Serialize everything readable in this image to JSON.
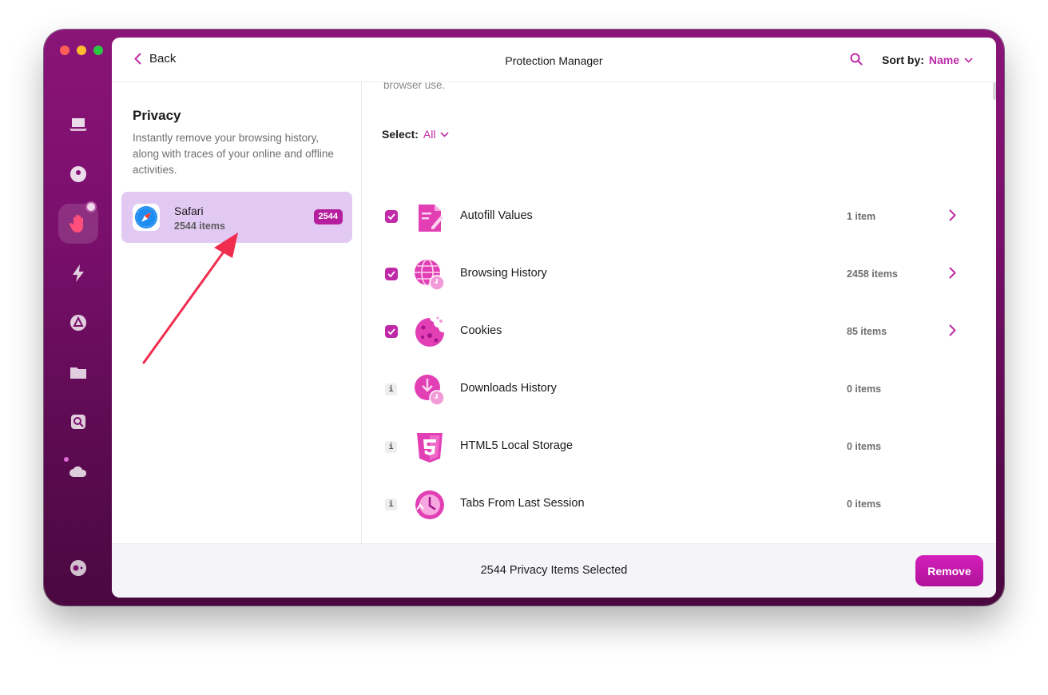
{
  "window": {
    "accent": "#c02aa8",
    "sidebar_color": "#7a0f6c"
  },
  "sidebar": {
    "items": [
      {
        "icon": "laptop-icon"
      },
      {
        "icon": "disc-icon"
      },
      {
        "icon": "hand-icon"
      },
      {
        "icon": "lightning-icon"
      },
      {
        "icon": "apps-icon"
      },
      {
        "icon": "folder-icon"
      },
      {
        "icon": "search-file-icon"
      },
      {
        "icon": "cloud-icon"
      },
      {
        "icon": "toggle-icon"
      }
    ]
  },
  "header": {
    "back_label": "Back",
    "title": "Protection Manager",
    "sort_label": "Sort by:",
    "sort_value": "Name"
  },
  "left": {
    "section_title": "Privacy",
    "section_description": "Instantly remove your browsing history, along with traces of your online and offline activities.",
    "app": {
      "name": "Safari",
      "count": "2544 items",
      "badge": "2544"
    }
  },
  "right": {
    "cut_text": "browser use.",
    "select_label": "Select:",
    "select_value": "All",
    "items": [
      {
        "label": "Autofill Values",
        "count": "1 item",
        "checked": true,
        "icon": "autofill-icon"
      },
      {
        "label": "Browsing History",
        "count": "2458 items",
        "checked": true,
        "icon": "globe-clock-icon"
      },
      {
        "label": "Cookies",
        "count": "85 items",
        "checked": true,
        "icon": "cookie-icon"
      },
      {
        "label": "Downloads History",
        "count": "0 items",
        "checked": false,
        "icon": "download-icon"
      },
      {
        "label": "HTML5 Local Storage",
        "count": "0 items",
        "checked": false,
        "icon": "html5-icon"
      },
      {
        "label": "Tabs From Last Session",
        "count": "0 items",
        "checked": false,
        "icon": "clock-icon"
      }
    ]
  },
  "footer": {
    "summary": "2544 Privacy Items Selected",
    "remove_label": "Remove"
  }
}
